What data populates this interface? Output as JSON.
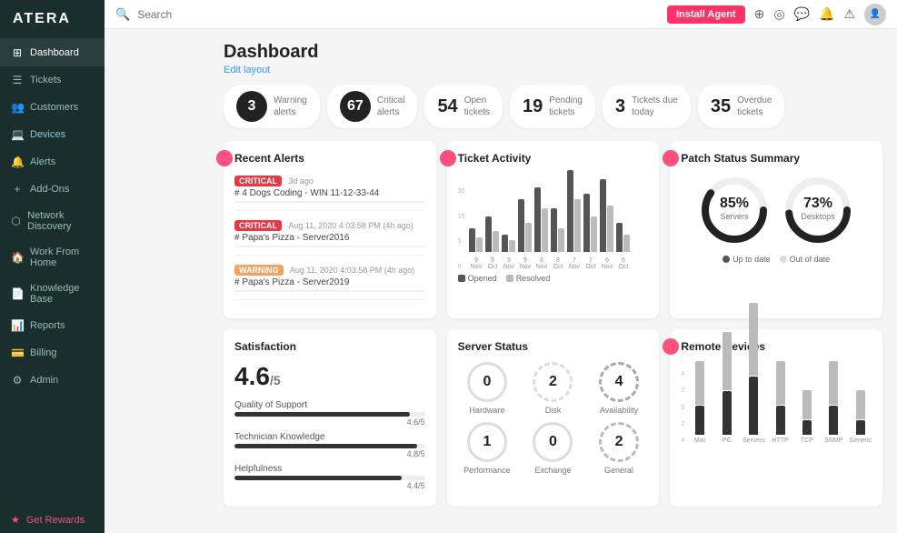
{
  "app": {
    "name": "ATERA",
    "logo": "ATERA"
  },
  "topbar": {
    "search_placeholder": "Search",
    "install_agent_label": "Install Agent",
    "icons": [
      "plus",
      "location",
      "chat",
      "bell",
      "warning"
    ]
  },
  "sidebar": {
    "items": [
      {
        "id": "dashboard",
        "label": "Dashboard",
        "icon": "⊞",
        "active": true
      },
      {
        "id": "tickets",
        "label": "Tickets",
        "icon": "🎫"
      },
      {
        "id": "customers",
        "label": "Customers",
        "icon": "👥"
      },
      {
        "id": "devices",
        "label": "Devices",
        "icon": "💻",
        "highlighted": true
      },
      {
        "id": "alerts",
        "label": "Alerts",
        "icon": "🔔"
      },
      {
        "id": "addons",
        "label": "Add-Ons",
        "icon": "🧩"
      },
      {
        "id": "network",
        "label": "Network Discovery",
        "icon": "🌐"
      },
      {
        "id": "workfromhome",
        "label": "Work From Home",
        "icon": "🏠"
      },
      {
        "id": "knowledge",
        "label": "Knowledge Base",
        "icon": "📚"
      },
      {
        "id": "reports",
        "label": "Reports",
        "icon": "📊"
      },
      {
        "id": "billing",
        "label": "Billing",
        "icon": "💳"
      },
      {
        "id": "admin",
        "label": "Admin",
        "icon": "⚙️"
      }
    ],
    "rewards_label": "Get Rewards"
  },
  "page": {
    "title": "Dashboard",
    "edit_layout": "Edit layout"
  },
  "stats": [
    {
      "number": "3",
      "dark": true,
      "label_line1": "Warning",
      "label_line2": "alerts"
    },
    {
      "number": "67",
      "dark": true,
      "label_line1": "Critical",
      "label_line2": "alerts"
    },
    {
      "number": "54",
      "dark": false,
      "label_line1": "Open",
      "label_line2": "tickets"
    },
    {
      "number": "19",
      "dark": false,
      "label_line1": "Pending",
      "label_line2": "tickets"
    },
    {
      "number": "3",
      "dark": false,
      "label_line1": "Tickets due",
      "label_line2": "today"
    },
    {
      "number": "35",
      "dark": false,
      "label_line1": "Overdue",
      "label_line2": "tickets"
    }
  ],
  "recent_alerts": {
    "title": "Recent Alerts",
    "alerts": [
      {
        "badge": "CRITICAL",
        "type": "critical",
        "time": "3d ago",
        "device": "# 4 Dogs Coding - WIN 11-12-33-44"
      },
      {
        "badge": "CRITICAL",
        "type": "critical",
        "time": "Aug 11, 2020 4:03:58 PM (4h ago)",
        "device": "# Papa's Pizza - Server2016"
      },
      {
        "badge": "WARNING",
        "type": "warning",
        "time": "Aug 11, 2020 4:03:58 PM (4h ago)",
        "device": "# Papa's Pizza - Server2019"
      }
    ]
  },
  "ticket_activity": {
    "title": "Ticket Activity",
    "bars": [
      {
        "label": "9 Nov",
        "opened": 8,
        "resolved": 5
      },
      {
        "label": "9 Oct",
        "opened": 12,
        "resolved": 7
      },
      {
        "label": "9 Nov",
        "opened": 6,
        "resolved": 4
      },
      {
        "label": "9 Nov",
        "opened": 18,
        "resolved": 10
      },
      {
        "label": "8 Nov",
        "opened": 22,
        "resolved": 15
      },
      {
        "label": "8 Oct",
        "opened": 15,
        "resolved": 8
      },
      {
        "label": "7 Nov",
        "opened": 28,
        "resolved": 18
      },
      {
        "label": "7 Oct",
        "opened": 20,
        "resolved": 12
      },
      {
        "label": "6 Nov",
        "opened": 25,
        "resolved": 16
      },
      {
        "label": "6 Oct",
        "opened": 10,
        "resolved": 6
      }
    ],
    "legend_opened": "Opened",
    "legend_resolved": "Resolved",
    "y_labels": [
      "30",
      "15",
      "5",
      "0"
    ]
  },
  "patch_status": {
    "title": "Patch Status Summary",
    "servers": {
      "percent": 85,
      "label": "Servers"
    },
    "desktops": {
      "percent": 73,
      "label": "Desktops"
    },
    "legend_uptodate": "Up to date",
    "legend_outofdate": "Out of date"
  },
  "satisfaction": {
    "title": "Satisfaction",
    "score": "4.6",
    "max": "/5",
    "metrics": [
      {
        "label": "Quality of Support",
        "value": 4.6,
        "max": 5,
        "display": "4.6/5"
      },
      {
        "label": "Technician Knowledge",
        "value": 4.8,
        "max": 5,
        "display": "4.8/5"
      },
      {
        "label": "Helpfulness",
        "value": 4.4,
        "max": 5,
        "display": "4.4/5"
      }
    ]
  },
  "server_status": {
    "title": "Server Status",
    "items": [
      {
        "label": "Hardware",
        "value": "0",
        "style": "normal"
      },
      {
        "label": "Disk",
        "value": "2",
        "style": "warning"
      },
      {
        "label": "Availability",
        "value": "4",
        "style": "partial"
      },
      {
        "label": "Performance",
        "value": "1",
        "style": "normal"
      },
      {
        "label": "Exchange",
        "value": "0",
        "style": "normal"
      },
      {
        "label": "General",
        "value": "2",
        "style": "partial"
      }
    ]
  },
  "remote_devices": {
    "title": "Remote Devices",
    "bars": [
      {
        "label": "Mac",
        "light": 3,
        "dark": 2
      },
      {
        "label": "PC",
        "light": 4,
        "dark": 3
      },
      {
        "label": "Servers",
        "light": 5,
        "dark": 4
      },
      {
        "label": "HTTP",
        "light": 3,
        "dark": 2
      },
      {
        "label": "TCP",
        "light": 2,
        "dark": 1
      },
      {
        "label": "SNMP",
        "light": 3,
        "dark": 2
      },
      {
        "label": "Generic",
        "light": 2,
        "dark": 1
      }
    ],
    "y_labels": [
      "4",
      "2",
      "0",
      "2",
      "4"
    ]
  }
}
